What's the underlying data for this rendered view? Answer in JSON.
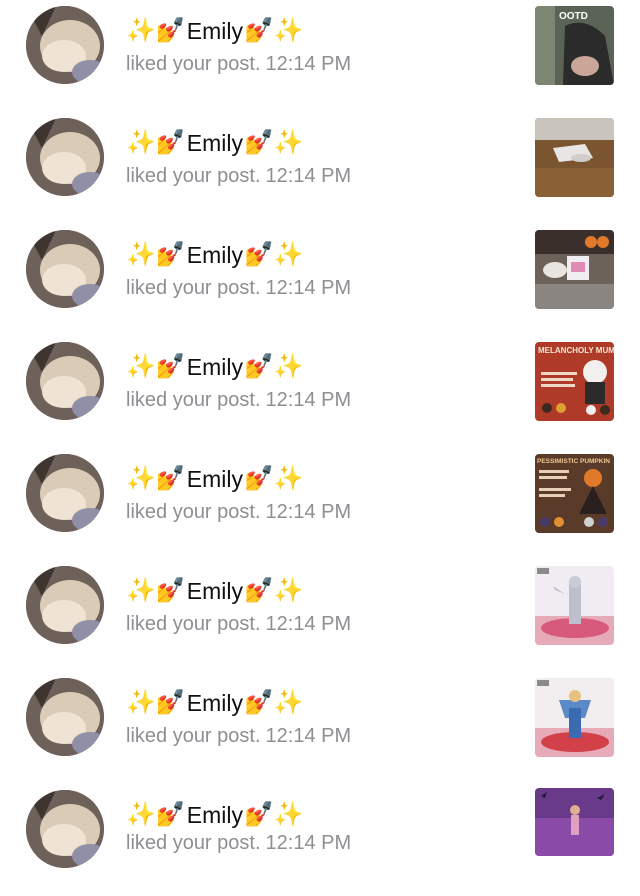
{
  "notifications": [
    {
      "name": "Emily",
      "prefix": "✨💅",
      "suffix": "💅✨",
      "action": "liked your post.",
      "time": "12:14 PM",
      "thumb_label": "OOTD"
    },
    {
      "name": "Emily",
      "prefix": "✨💅",
      "suffix": "💅✨",
      "action": "liked your post.",
      "time": "12:14 PM",
      "thumb_label": ""
    },
    {
      "name": "Emily",
      "prefix": "✨💅",
      "suffix": "💅✨",
      "action": "liked your post.",
      "time": "12:14 PM",
      "thumb_label": ""
    },
    {
      "name": "Emily",
      "prefix": "✨💅",
      "suffix": "💅✨",
      "action": "liked your post.",
      "time": "12:14 PM",
      "thumb_label": "MELANCHOLY MUMMY"
    },
    {
      "name": "Emily",
      "prefix": "✨💅",
      "suffix": "💅✨",
      "action": "liked your post.",
      "time": "12:14 PM",
      "thumb_label": "PESSIMISTIC PUMPKIN"
    },
    {
      "name": "Emily",
      "prefix": "✨💅",
      "suffix": "💅✨",
      "action": "liked your post.",
      "time": "12:14 PM",
      "thumb_label": ""
    },
    {
      "name": "Emily",
      "prefix": "✨💅",
      "suffix": "💅✨",
      "action": "liked your post.",
      "time": "12:14 PM",
      "thumb_label": ""
    },
    {
      "name": "Emily",
      "prefix": "✨💅",
      "suffix": "💅✨",
      "action": "liked your post.",
      "time": "12:14 PM",
      "thumb_label": ""
    }
  ],
  "icons": {
    "avatar": "cat-photo-avatar",
    "thumbnail": "post-thumbnail-image"
  },
  "colors": {
    "name_text": "#111111",
    "secondary_text": "#8e8e93",
    "background": "#ffffff"
  }
}
